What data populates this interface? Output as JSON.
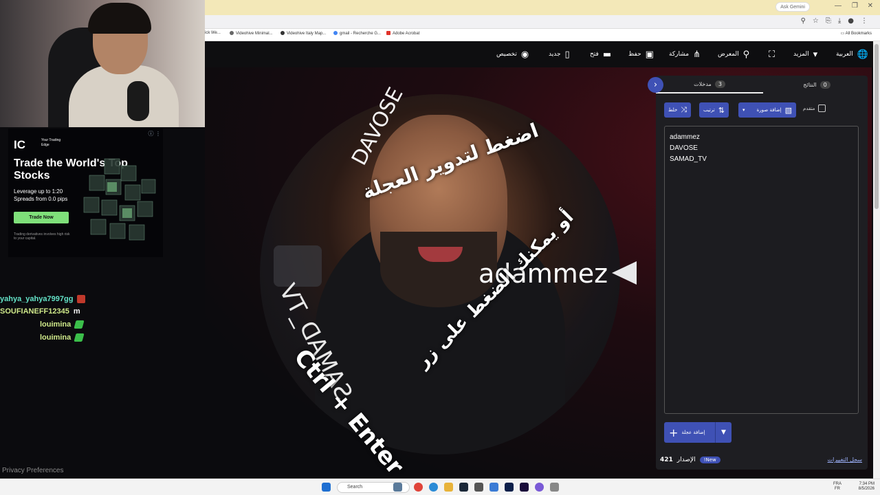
{
  "browser": {
    "ai_pill": "Ask Gemini",
    "bookmarks": [
      {
        "label": "ick We...",
        "color": "#888"
      },
      {
        "label": "Videohive Minimal...",
        "color": "#666"
      },
      {
        "label": "Videohive Italy Map...",
        "color": "#333"
      },
      {
        "label": "gmail - Recherche G...",
        "color": "#4285f4"
      },
      {
        "label": "Adobe Acrobat",
        "color": "#e0332a"
      }
    ],
    "all_bookmarks": "All Bookmarks"
  },
  "toolbar": {
    "language": "العربية",
    "more": "المزيد",
    "gallery": "المعرض",
    "share": "مشاركة",
    "save": "حفظ",
    "open": "فتح",
    "new": "جديد",
    "customize": "تخصيص"
  },
  "wheel": {
    "entries_on_wheel": [
      "adammez",
      "DAVOSE",
      "SAMAD_TV"
    ],
    "overlay_top": "اضغط لتدوير العجلة",
    "overlay_ctrl": "Ctrl + Enter",
    "overlay_bottom": "أو يمكنك الضغط على زر"
  },
  "panel": {
    "tab_entries": {
      "label": "مدخلات",
      "count": "3"
    },
    "tab_results": {
      "label": "النتائج",
      "count": "0"
    },
    "shuffle": "خلط",
    "sort": "ترتيب",
    "add_image": "إضافة صورة",
    "advanced": "متقدم",
    "entries": [
      "adammez",
      "DAVOSE",
      "SAMAD_TV"
    ],
    "add_wheel": "إضافة عجلة",
    "version_label": "الإصدار",
    "version_number": "421",
    "new_badge": "New!",
    "changelog": "سجل التغييرات"
  },
  "ad": {
    "logo": "IC",
    "tagline": "Your Trading Edge",
    "headline": "Trade the World's Top Stocks",
    "sub1": "Leverage up to 1:20",
    "sub2": "Spreads from 0.0 pips",
    "cta": "Trade Now",
    "fine_print": "Trading derivatives involves high risk to your capital."
  },
  "chat": [
    {
      "name": "yahya_yahya7997gg",
      "message": "",
      "badge_color": "#c0392b",
      "name_color": "#64e3c8"
    },
    {
      "name": "SOUFIANEFF12345",
      "message": "m",
      "badge_color": "",
      "name_color": "#cfe98a"
    },
    {
      "name": "louimina",
      "message": "",
      "badge_color": "#3bbf4a",
      "name_color": "#cfe98a"
    },
    {
      "name": "louimina",
      "message": "",
      "badge_color": "#3bbf4a",
      "name_color": "#cfe98a"
    }
  ],
  "privacy": "Privacy Preferences",
  "taskbar": {
    "search": "Search",
    "lang_top": "FRA",
    "lang_bottom": "FR",
    "time": "7:34 PM",
    "date": "8/5/2026"
  },
  "colors": {
    "accent": "#3f51b5",
    "panel_bg": "#1e1e22",
    "chrome_top": "#f3e8b8"
  }
}
